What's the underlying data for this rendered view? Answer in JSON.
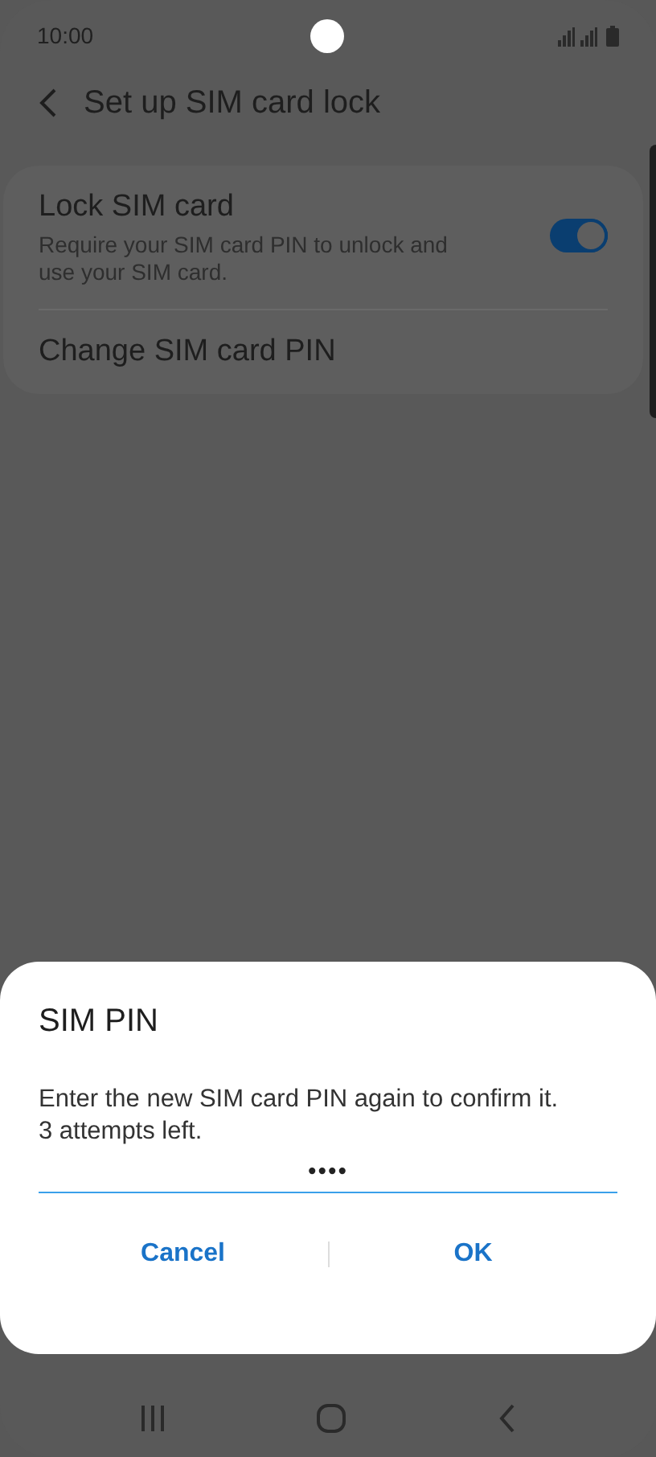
{
  "status_bar": {
    "time": "10:00"
  },
  "header": {
    "title": "Set up SIM card lock"
  },
  "settings": [
    {
      "kind": "toggle",
      "title": "Lock SIM card",
      "subtitle": "Require your SIM card PIN to unlock and use your SIM card.",
      "on": true
    },
    {
      "kind": "link",
      "title": "Change SIM card PIN"
    }
  ],
  "dialog": {
    "title": "SIM PIN",
    "message": "Enter the new SIM card PIN again to confirm it.\n3 attempts left.",
    "pin_value": "••••",
    "buttons": [
      "Cancel",
      "OK"
    ]
  }
}
